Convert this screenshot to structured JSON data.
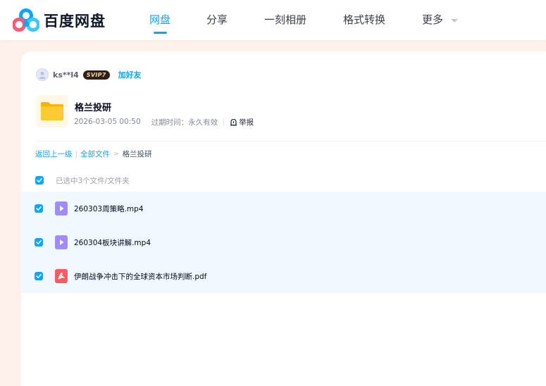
{
  "brand": {
    "name": "百度网盘",
    "logo_icon": "baidu-netdisk-logo",
    "accent": "#06a7ff"
  },
  "nav": {
    "items": [
      {
        "label": "网盘",
        "active": true
      },
      {
        "label": "分享",
        "active": false
      },
      {
        "label": "一刻相册",
        "active": false
      },
      {
        "label": "格式转换",
        "active": false
      },
      {
        "label": "更多",
        "active": false,
        "icon": "caret-down-icon"
      }
    ]
  },
  "share": {
    "sharer_name": "ks**l4",
    "vip_badge": "SVIP7",
    "add_friend": "加好友",
    "title": "格兰投研",
    "date": "2026-03-05 00:50",
    "expire_label": "过期时间：永久有效",
    "report_label": "举报"
  },
  "breadcrumb": {
    "back": "返回上一级",
    "separator": "|",
    "all_files": "全部文件",
    "arrow": ">",
    "current": "格兰投研"
  },
  "selection": {
    "summary": "已选中3个文件/文件夹",
    "all_checked": true
  },
  "files": [
    {
      "name": "260303周策略.mp4",
      "type": "video",
      "checked": true
    },
    {
      "name": "260304板块讲解.mp4",
      "type": "video",
      "checked": true
    },
    {
      "name": "伊朗战争冲击下的全球资本市场判断.pdf",
      "type": "pdf",
      "checked": true
    }
  ]
}
